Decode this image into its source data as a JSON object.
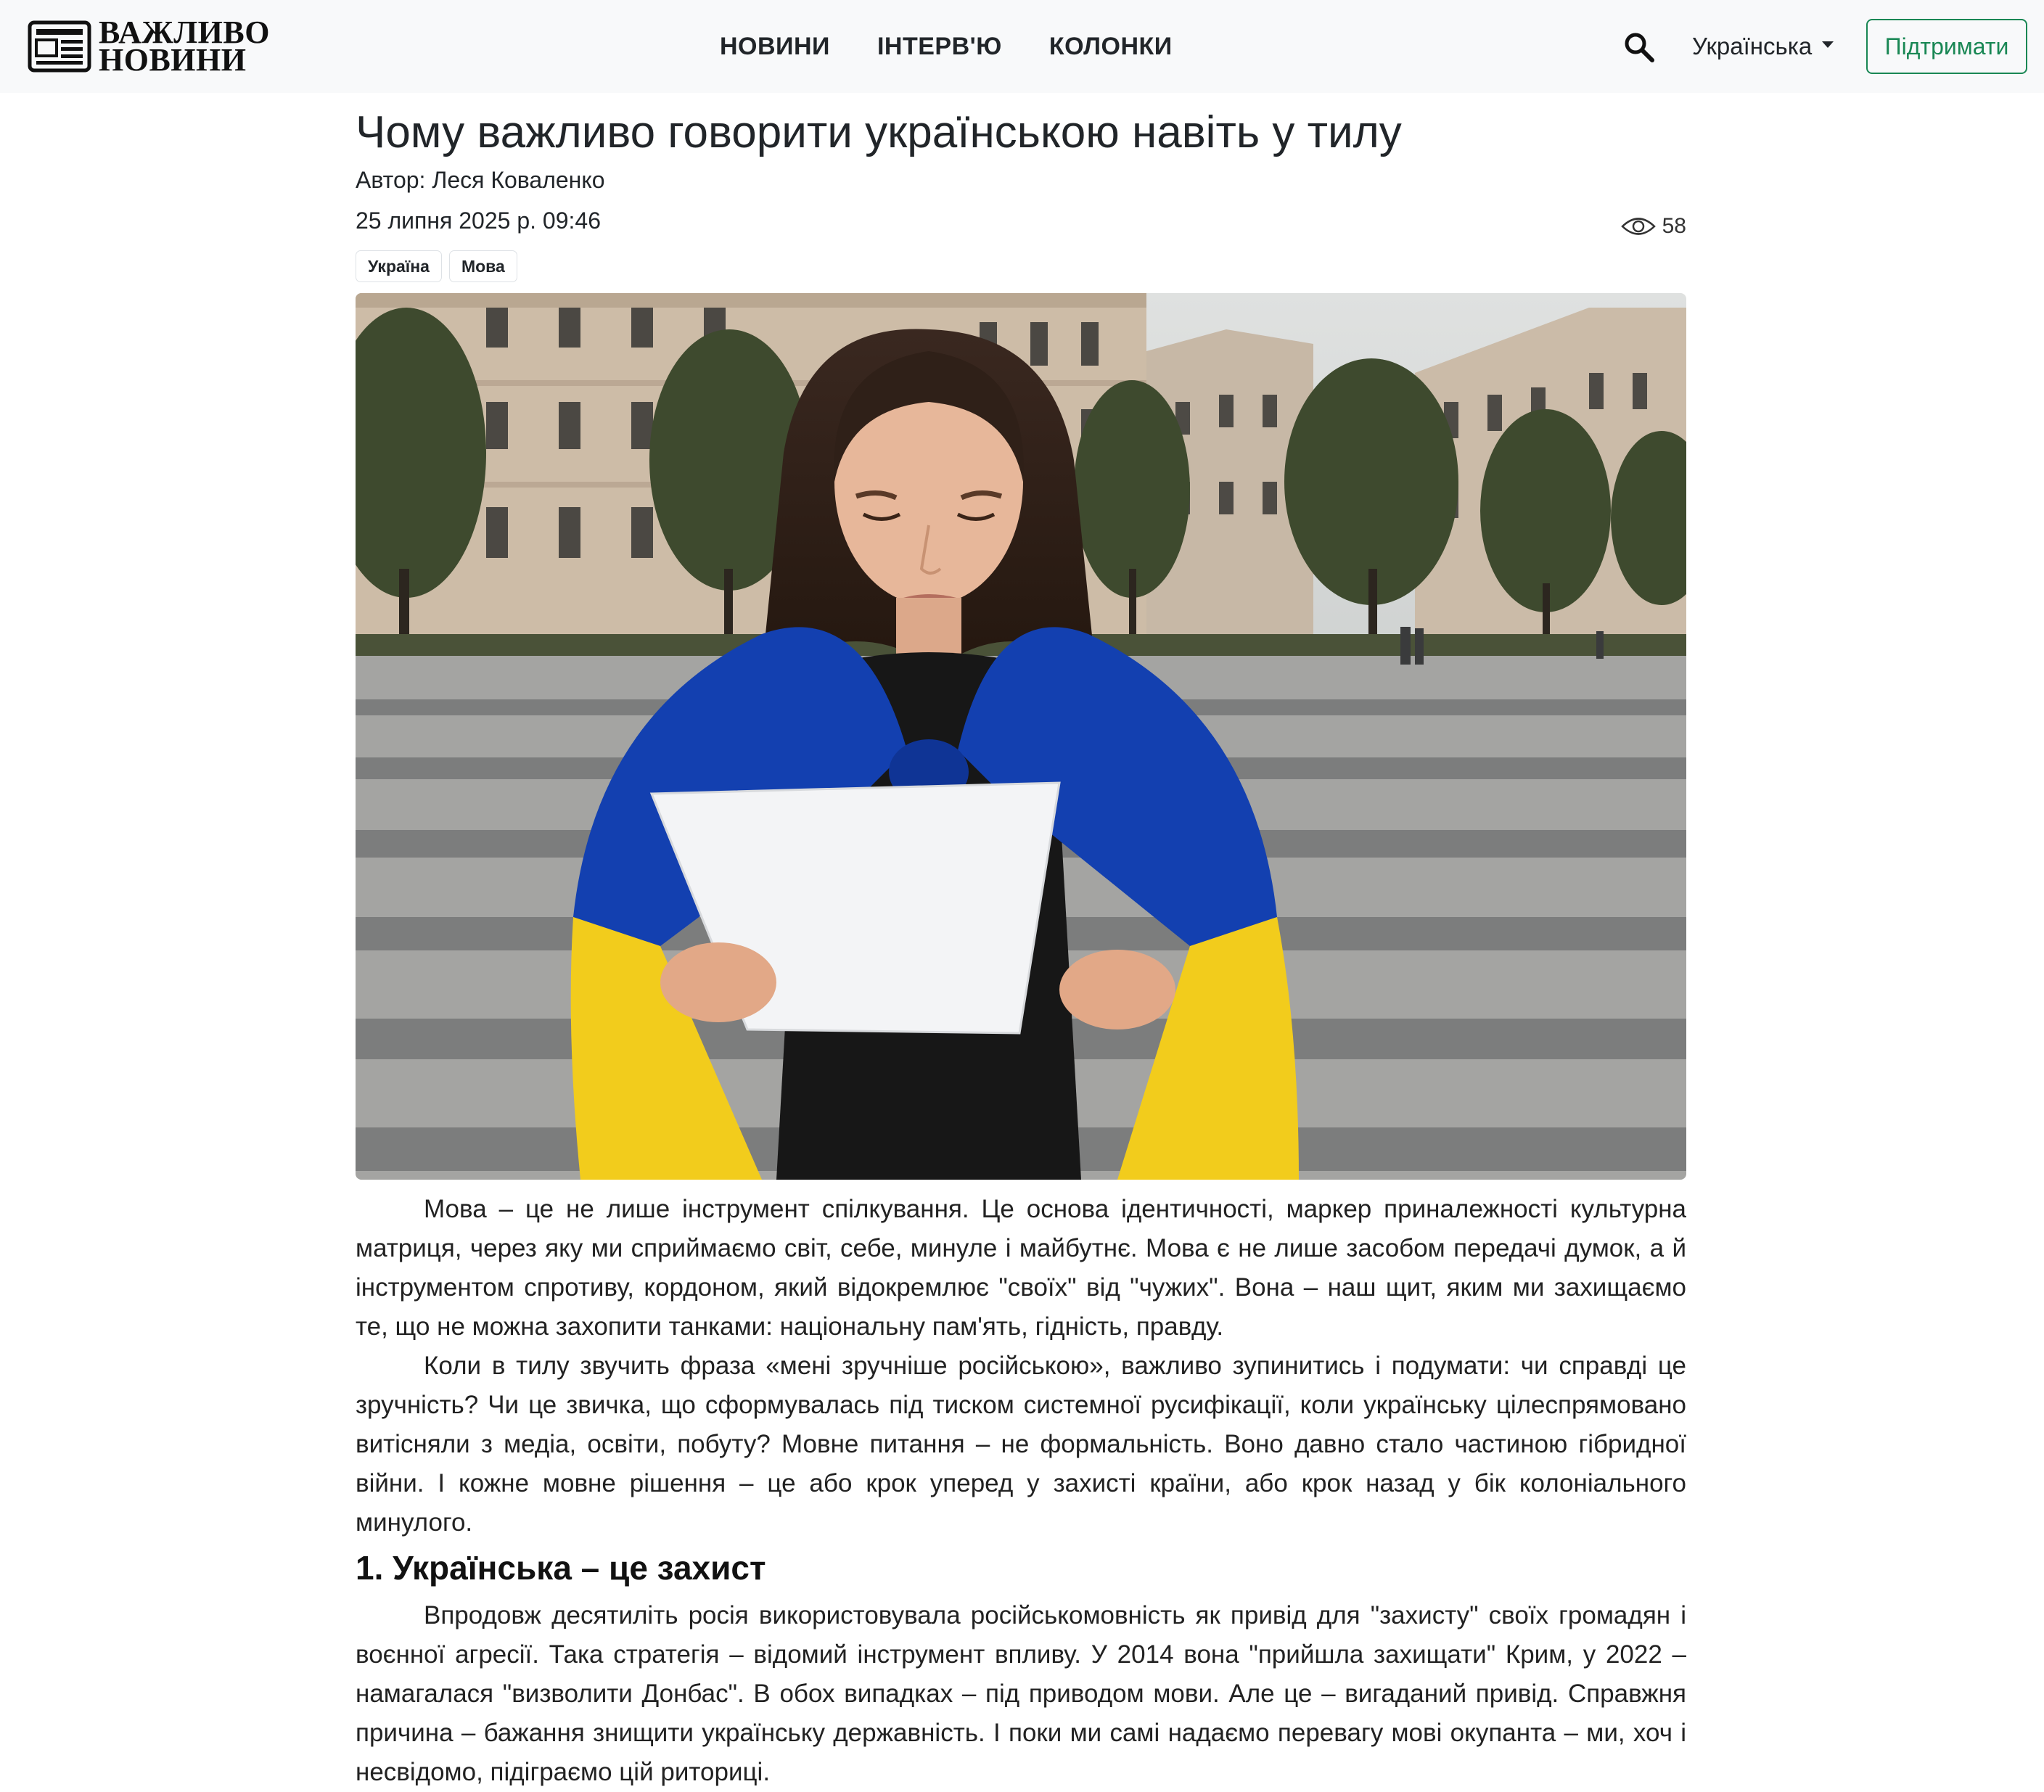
{
  "site": {
    "logo_line1": "ВАЖЛИВО",
    "logo_line2": "НОВИНИ"
  },
  "nav": {
    "items": [
      {
        "label": "НОВИНИ"
      },
      {
        "label": "ІНТЕРВ'Ю"
      },
      {
        "label": "КОЛОНКИ"
      }
    ],
    "search_icon": "search-icon",
    "language": "Українська",
    "support_label": "Підтримати"
  },
  "article": {
    "title": "Чому важливо говорити українською навіть у тилу",
    "author": "Автор: Леся Коваленко",
    "date": "25 липня 2025 р. 09:46",
    "views": "58",
    "tags": [
      {
        "label": "Україна"
      },
      {
        "label": "Мова"
      }
    ],
    "paragraphs": [
      "Мова – це не лише інструмент спілкування. Це основа ідентичності, маркер приналежності культурна матриця, через яку ми сприймаємо світ, себе, минуле і майбутнє. Мова є не лише засобом передачі думок, а й інструментом спротиву, кордоном, який відокремлює \"своїх\" від \"чужих\". Вона – наш щит, яким ми захищаємо те, що не можна захопити танками: національну пам'ять, гідність, правду.",
      "Коли в тилу звучить фраза «мені зручніше російською», важливо зупинитись і подумати: чи справді це зручність? Чи це звичка, що сформувалась під тиском системної русифікації, коли українську цілеспрямовано витісняли з медіа, освіти, побуту? Мовне питання – не формальність. Воно давно стало частиною гібридної війни. І кожне мовне рішення – це або крок уперед у захисті країни, або крок назад у бік колоніального минулого."
    ],
    "section_heading": "1. Українська – це захист",
    "section_paragraph": "Впродовж десятиліть росія використовувала російськомовність як привід для \"захисту\" своїх громадян і воєнної агресії. Така стратегія – відомий інструмент впливу. У 2014 вона \"прийшла захищати\" Крим, у 2022 – намагалася \"визволити Донбас\". В обох випадках – під приводом мови. Але це – вигаданий привід. Справжня причина – бажання знищити українську державність. І поки ми самі надаємо перевагу мові окупанта – ми, хоч і несвідомо, підіграємо цій риториці."
  },
  "colors": {
    "navbar_bg": "#f8f9fa",
    "support_green": "#198754",
    "flag_blue": "#1340b0",
    "flag_yellow": "#f2cc1c"
  }
}
